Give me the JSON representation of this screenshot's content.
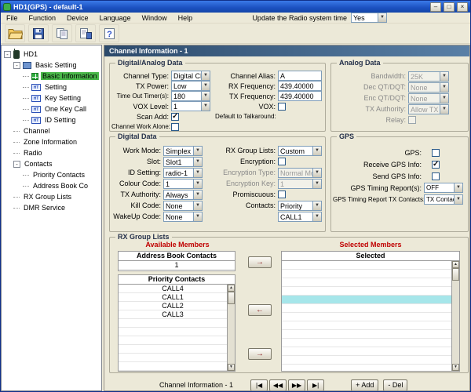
{
  "titlebar": {
    "title": "HD1(GPS) - default-1",
    "minimize_glyph": "–",
    "maximize_glyph": "□",
    "close_glyph": "×"
  },
  "menubar": {
    "items": [
      "File",
      "Function",
      "Device",
      "Language",
      "Window",
      "Help"
    ],
    "update_label": "Update the Radio system time",
    "update_value": "Yes"
  },
  "icons": {
    "dropdown": "▼",
    "scroll_up": "▲",
    "scroll_down": "▼",
    "arrow_right": "→",
    "arrow_left": "←",
    "expander_minus": "-"
  },
  "tree": {
    "items": [
      {
        "label": "HD1",
        "level": 0,
        "expander": true,
        "icon": "ic-radio",
        "icon_name": "radio-icon"
      },
      {
        "label": "Basic Setting",
        "level": 1,
        "expander": true,
        "icon": "ic-folder",
        "icon_name": "folder-icon"
      },
      {
        "label": "Basic Information",
        "level": 2,
        "icon": "ic-grid",
        "icon_name": "grid-icon",
        "selected": true
      },
      {
        "label": "Setting",
        "level": 2,
        "icon": "ic-ht",
        "icon_name": "radio-device-icon"
      },
      {
        "label": "Key Setting",
        "level": 2,
        "icon": "ic-ht",
        "icon_name": "radio-device-icon"
      },
      {
        "label": "One Key Call",
        "level": 2,
        "icon": "ic-ht",
        "icon_name": "radio-device-icon"
      },
      {
        "label": "ID Setting",
        "level": 2,
        "icon": "ic-ht",
        "icon_name": "radio-device-icon"
      },
      {
        "label": "Channel",
        "level": 1
      },
      {
        "label": "Zone Information",
        "level": 1
      },
      {
        "label": "Radio",
        "level": 1
      },
      {
        "label": "Contacts",
        "level": 1,
        "expander": true
      },
      {
        "label": "Priority Contacts",
        "level": 2
      },
      {
        "label": "Address Book Co",
        "level": 2
      },
      {
        "label": "RX Group Lists",
        "level": 1
      },
      {
        "label": "DMR Service",
        "level": 1
      }
    ]
  },
  "panel": {
    "title": "Channel Information - 1"
  },
  "digital_analog": {
    "title": "Digital/Analog Data",
    "channel_type_label": "Channel Type:",
    "channel_type_value": "Digital CH",
    "tx_power_label": "TX Power:",
    "tx_power_value": "Low",
    "timeout_label": "Time Out Timer(s):",
    "timeout_value": "180",
    "vox_level_label": "VOX Level:",
    "vox_level_value": "1",
    "scan_add_label": "Scan Add:",
    "work_alone_label": "Channel Work Alone:",
    "alias_label": "Channel Alias:",
    "alias_value": "A",
    "rx_freq_label": "RX Frequency:",
    "rx_freq_value": "439.40000",
    "tx_freq_label": "TX Frequency:",
    "tx_freq_value": "439.40000",
    "vox_label": "VOX:",
    "talkaround_label": "Default to Talkaround:"
  },
  "analog": {
    "title": "Analog Data",
    "bandwidth_label": "Bandwidth:",
    "bandwidth_value": "25K",
    "dec_qt_label": "Dec QT/DQT:",
    "dec_qt_value": "None",
    "enc_qt_label": "Enc QT/DQT:",
    "enc_qt_value": "None",
    "tx_authority_label": "TX Authority:",
    "tx_authority_value": "Allow TX",
    "relay_label": "Relay:"
  },
  "digital": {
    "title": "Digital Data",
    "work_mode_label": "Work Mode:",
    "work_mode_value": "Simplex",
    "slot_label": "Slot:",
    "slot_value": "Slot1",
    "id_setting_label": "ID Setting:",
    "id_setting_value": "radio-1",
    "colour_code_label": "Colour Code:",
    "colour_code_value": "1",
    "tx_authority_label": "TX Authority:",
    "tx_authority_value": "Always",
    "kill_code_label": "Kill Code:",
    "kill_code_value": "None",
    "wakeup_code_label": "WakeUp Code:",
    "wakeup_code_value": "None",
    "rx_group_label": "RX Group Lists:",
    "rx_group_value": "Custom",
    "encryption_label": "Encryption:",
    "encryption_type_label": "Encryption Type:",
    "encryption_type_value": "Normal Mode",
    "encryption_key_label": "Encryption Key:",
    "encryption_key_value": "1",
    "promiscuous_label": "Promiscuous:",
    "contacts_label": "Contacts:",
    "contacts_value": "Priority",
    "contacts2_value": "CALL1"
  },
  "gps": {
    "title": "GPS",
    "gps_label": "GPS:",
    "receive_label": "Receive GPS Info:",
    "send_label": "Send GPS Info:",
    "timing_label": "GPS Timing Report(s):",
    "timing_value": "OFF",
    "timing_tx_label": "GPS Timing Report TX Contacts:",
    "timing_tx_value": "TX Contact"
  },
  "checks": {
    "scan_add": true,
    "work_alone": false,
    "vox": false,
    "relay": false,
    "encryption": false,
    "promiscuous": false,
    "gps": false,
    "receive_gps": true,
    "send_gps": false
  },
  "rx_group": {
    "title": "RX Group Lists",
    "available_title": "Available Members",
    "selected_title": "Selected Members",
    "address_book_header": "Address Book Contacts",
    "address_book_items": [
      "1"
    ],
    "priority_header": "Priority Contacts",
    "priority_items": [
      "CALL4",
      "CALL1",
      "CALL2",
      "CALL3"
    ],
    "selected_header": "Selected",
    "selected_rows": 13,
    "selected_highlight_index": 4
  },
  "bottom": {
    "label": "Channel Information - 1",
    "nav_glyphs": [
      "|◀",
      "◀◀",
      "▶▶",
      "▶|"
    ],
    "add_label": "+ Add",
    "del_label": "- Del"
  }
}
